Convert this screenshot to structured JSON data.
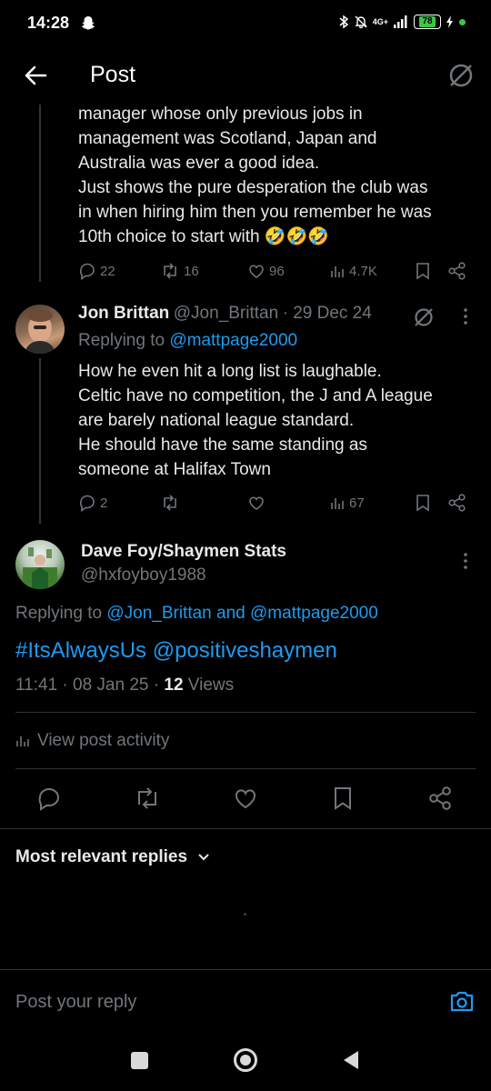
{
  "status_bar": {
    "time": "14:28",
    "network": "4G+",
    "battery": "78"
  },
  "header": {
    "title": "Post"
  },
  "parent_post": {
    "lines": [
      "manager whose only previous jobs in",
      "management was Scotland, Japan and",
      "Australia was ever a good idea.",
      "Just shows the pure desperation the club was",
      "in when hiring him then you remember he was",
      "10th choice to start with 🤣🤣🤣"
    ],
    "replies": "22",
    "reposts": "16",
    "likes": "96",
    "views": "4.7K"
  },
  "reply_post": {
    "name": "Jon Brittan",
    "handle": "@Jon_Brittan",
    "date": "· 29 Dec 24",
    "replying_prefix": "Replying to",
    "replying_to": "@mattpage2000",
    "lines": [
      "How he even hit a long list is laughable.",
      "Celtic have no competition, the J and A league",
      "are barely national league standard.",
      "He should have the same standing as",
      "someone at Halifax Town"
    ],
    "replies": "2",
    "views": "67"
  },
  "main_post": {
    "name": "Dave Foy/Shaymen Stats",
    "handle": "@hxfoyboy1988",
    "replying_prefix": "Replying to",
    "replying_to_1": "@Jon_Brittan",
    "replying_and": "and",
    "replying_to_2": "@mattpage2000",
    "hashtag": "#ItsAlwaysUs",
    "mention": "@positiveshaymen",
    "time": "11:41 · 08 Jan 25 ·",
    "views_count": "12",
    "views_label": "Views",
    "activity_label": "View post activity"
  },
  "replies_section": {
    "sort_label": "Most relevant replies"
  },
  "reply_box": {
    "placeholder": "Post your reply"
  },
  "colors": {
    "background": "#000000",
    "text": "#e7e9ea",
    "muted": "#71767b",
    "accent": "#1d9bf0",
    "divider": "#2f3336"
  }
}
